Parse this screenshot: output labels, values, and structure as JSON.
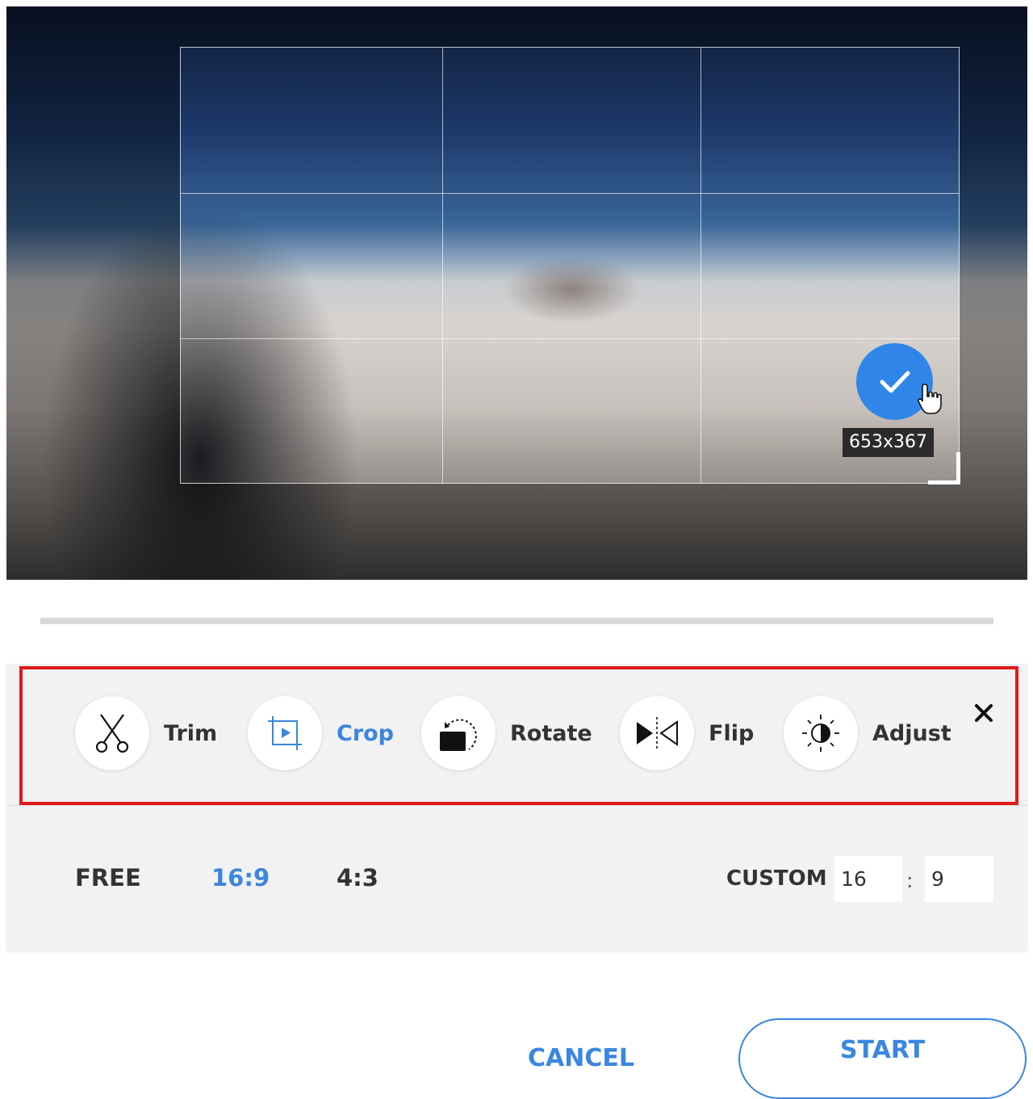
{
  "preview": {
    "crop_size_label": "653x367"
  },
  "toolbar": {
    "tools": [
      {
        "label": "Trim",
        "icon": "scissors-icon",
        "active": false
      },
      {
        "label": "Crop",
        "icon": "crop-icon",
        "active": true
      },
      {
        "label": "Rotate",
        "icon": "rotate-icon",
        "active": false
      },
      {
        "label": "Flip",
        "icon": "flip-icon",
        "active": false
      },
      {
        "label": "Adjust",
        "icon": "brightness-icon",
        "active": false
      }
    ],
    "close_icon": "close-icon"
  },
  "ratios": {
    "options": [
      {
        "label": "FREE",
        "active": false
      },
      {
        "label": "16:9",
        "active": true
      },
      {
        "label": "4:3",
        "active": false
      }
    ],
    "custom_label": "CUSTOM",
    "custom_width": "16",
    "custom_separator": ":",
    "custom_height": "9"
  },
  "buttons": {
    "cancel": "CANCEL",
    "start": "START"
  },
  "colors": {
    "accent": "#3a86e0",
    "highlight_border": "#e01818",
    "confirm": "#2f86e8"
  }
}
